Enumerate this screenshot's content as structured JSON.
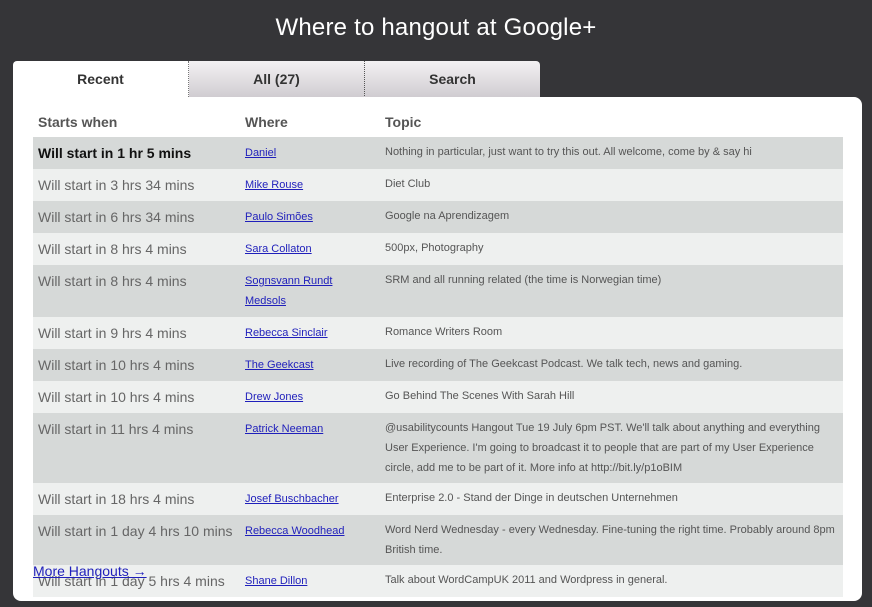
{
  "header": {
    "title": "Where to hangout at Google+"
  },
  "tabs": [
    {
      "label": "Recent"
    },
    {
      "label": "All (27)"
    },
    {
      "label": "Search"
    }
  ],
  "table": {
    "columns": [
      "Starts when",
      "Where",
      "Topic"
    ],
    "rows": [
      {
        "when": "Will start in 1 hr 5 mins",
        "where": "Daniel",
        "topic": "Nothing in particular, just want to try this out. All welcome, come by & say hi"
      },
      {
        "when": "Will start in 3 hrs 34 mins",
        "where": "Mike Rouse",
        "topic": "Diet Club"
      },
      {
        "when": "Will start in 6 hrs 34 mins",
        "where": "Paulo Simões",
        "topic": "Google na Aprendizagem"
      },
      {
        "when": "Will start in 8 hrs 4 mins",
        "where": "Sara Collaton",
        "topic": "500px, Photography"
      },
      {
        "when": "Will start in 8 hrs 4 mins",
        "where": "Sognsvann Rundt Medsols",
        "topic": "SRM and all running related (the time is Norwegian time)"
      },
      {
        "when": "Will start in 9 hrs 4 mins",
        "where": "Rebecca Sinclair",
        "topic": "Romance Writers Room"
      },
      {
        "when": "Will start in 10 hrs 4 mins",
        "where": "The Geekcast",
        "topic": "Live recording of The Geekcast Podcast. We talk tech, news and gaming."
      },
      {
        "when": "Will start in 10 hrs 4 mins",
        "where": "Drew Jones",
        "topic": "Go Behind The Scenes With Sarah Hill"
      },
      {
        "when": "Will start in 11 hrs 4 mins",
        "where": "Patrick Neeman",
        "topic": "@usabilitycounts Hangout Tue 19 July 6pm PST. We'll talk about anything and everything User Experience. I'm going to broadcast it to people that are part of my User Experience circle, add me to be part of it. More info at http://bit.ly/p1oBIM"
      },
      {
        "when": "Will start in 18 hrs 4 mins",
        "where": "Josef Buschbacher",
        "topic": "Enterprise 2.0 - Stand der Dinge in deutschen Unternehmen"
      },
      {
        "when": "Will start in 1 day 4 hrs 10 mins",
        "where": "Rebecca Woodhead",
        "topic": "Word Nerd Wednesday - every Wednesday. Fine-tuning the right time. Probably around 8pm British time."
      },
      {
        "when": "Will start in 1 day 5 hrs 4 mins",
        "where": "Shane Dillon",
        "topic": "Talk about WordCampUK 2011 and Wordpress in general."
      }
    ]
  },
  "footer": {
    "more_link": "More Hangouts →"
  }
}
